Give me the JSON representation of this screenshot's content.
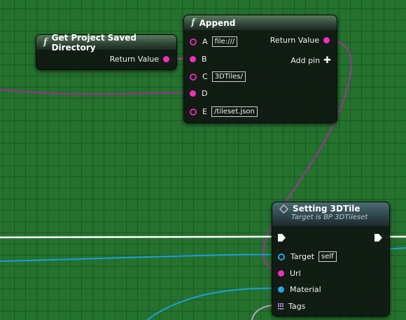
{
  "node_get_dir": {
    "title": "Get Project Saved Directory",
    "return_label": "Return Value"
  },
  "node_append": {
    "title": "Append",
    "return_label": "Return Value",
    "add_pin_label": "Add pin",
    "pins": [
      {
        "name": "A",
        "value": "file:///"
      },
      {
        "name": "B",
        "value": ""
      },
      {
        "name": "C",
        "value": "3DTiles/"
      },
      {
        "name": "D",
        "value": ""
      },
      {
        "name": "E",
        "value": "/tileset.json"
      }
    ]
  },
  "node_setting": {
    "title": "Setting 3DTile",
    "subtitle": "Target is BP 3DTileset",
    "target_label": "Target",
    "target_value": "self",
    "url_label": "Url",
    "material_label": "Material",
    "tags_label": "Tags"
  },
  "colors": {
    "graph_bg": "#25722f",
    "string_pin": "#f030c0",
    "object_pin": "#27a8e6",
    "exec_wire": "#ffffff",
    "array_pin": "#c995e6"
  },
  "icons": [
    "function-icon",
    "set-node-diamond-icon",
    "exec-pin-icon",
    "add-pin-plus-icon",
    "array-grid-icon"
  ]
}
